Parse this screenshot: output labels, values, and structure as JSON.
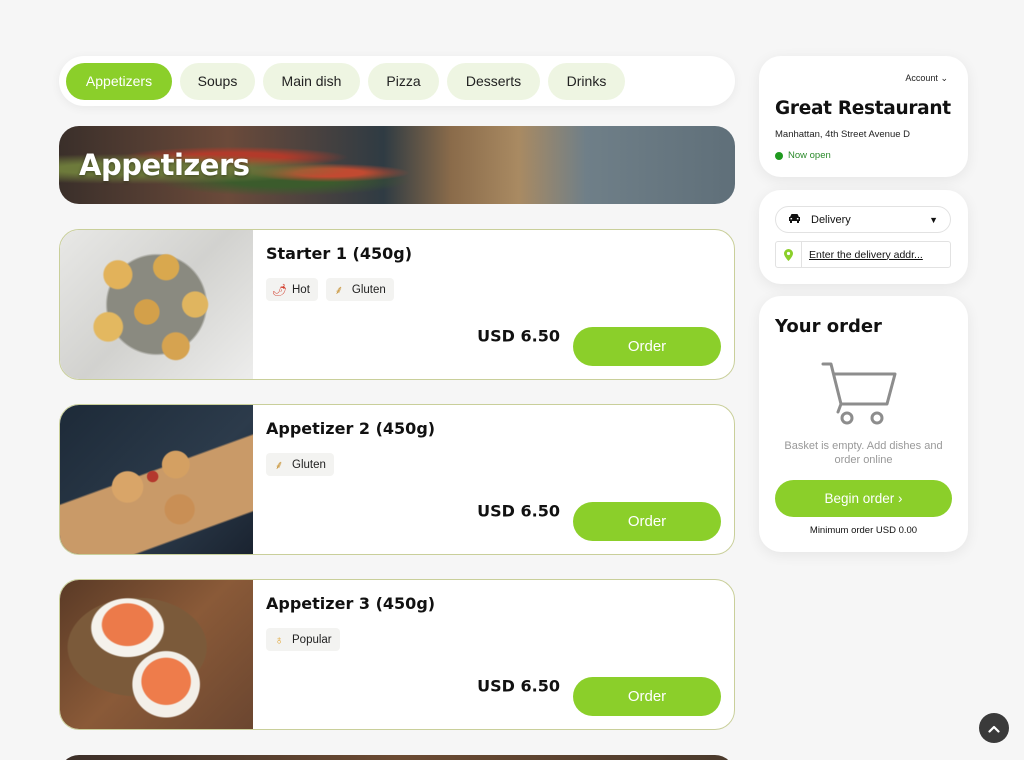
{
  "categories": [
    "Appetizers",
    "Soups",
    "Main dish",
    "Pizza",
    "Desserts",
    "Drinks"
  ],
  "active_category": "Appetizers",
  "banner": {
    "title": "Appetizers"
  },
  "products": [
    {
      "name": "Starter 1 (450g)",
      "tags": [
        {
          "label": "Hot",
          "icon": "chili-icon"
        },
        {
          "label": "Gluten",
          "icon": "wheat-icon"
        }
      ],
      "price": "USD 6.50",
      "order_label": "Order"
    },
    {
      "name": "Appetizer 2 (450g)",
      "tags": [
        {
          "label": "Gluten",
          "icon": "wheat-icon"
        }
      ],
      "price": "USD 6.50",
      "order_label": "Order"
    },
    {
      "name": "Appetizer 3 (450g)",
      "tags": [
        {
          "label": "Popular",
          "icon": "medal-icon"
        }
      ],
      "price": "USD 6.50",
      "order_label": "Order"
    }
  ],
  "restaurant": {
    "account_label": "Account",
    "name": "Great Restaurant",
    "address": "Manhattan, 4th Street Avenue D",
    "status": "Now open"
  },
  "delivery": {
    "mode": "Delivery",
    "address_placeholder": "Enter the delivery addr..."
  },
  "order": {
    "title": "Your order",
    "empty_text": "Basket is empty. Add dishes and order online",
    "begin_label": "Begin order ›",
    "min_order": "Minimum order USD 0.00"
  },
  "colors": {
    "accent": "#8bcf2a",
    "accent_light": "#eef5e2",
    "open_status": "#1f9a1f"
  }
}
